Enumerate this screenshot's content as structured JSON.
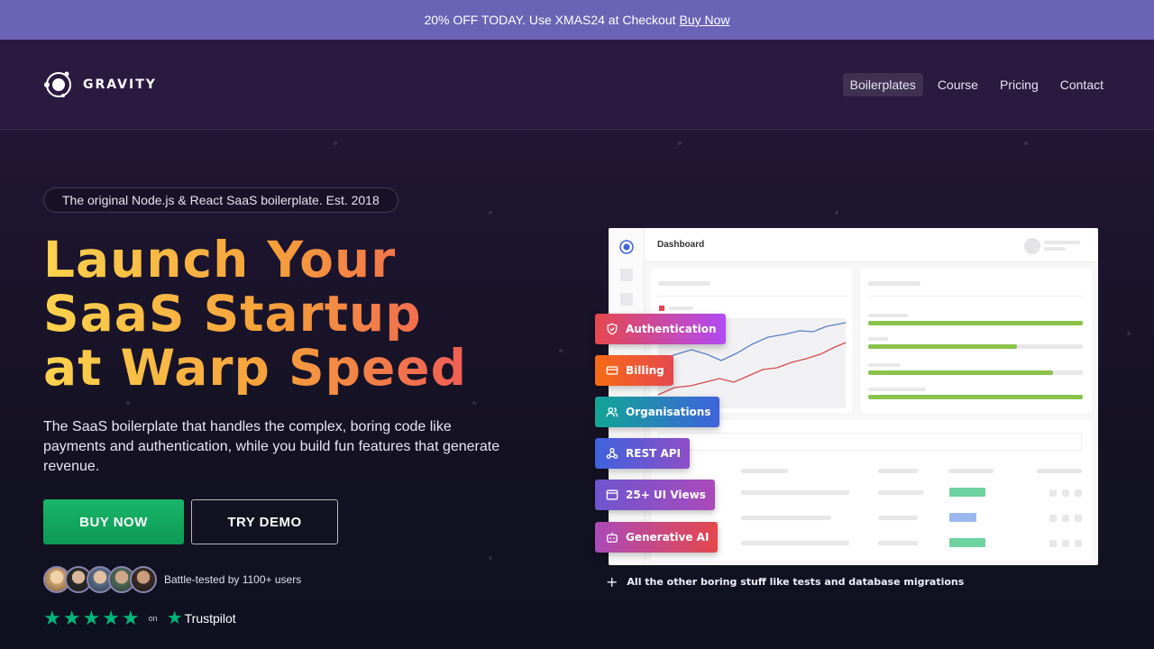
{
  "promo": {
    "text": "20% OFF TODAY. Use XMAS24 at Checkout",
    "link": "Buy Now"
  },
  "brand": {
    "name": "GRAVITY"
  },
  "nav": {
    "items": [
      {
        "label": "Boilerplates",
        "active": true
      },
      {
        "label": "Course"
      },
      {
        "label": "Pricing"
      },
      {
        "label": "Contact"
      }
    ]
  },
  "hero": {
    "badge": "The original Node.js & React SaaS boilerplate. Est. 2018",
    "headline": [
      "Launch Your",
      "SaaS Startup",
      "at Warp Speed"
    ],
    "subtitle": "The SaaS boilerplate that handles the complex, boring code like payments and authentication, while you build fun features that generate revenue.",
    "buy_label": "BUY NOW",
    "demo_label": "TRY DEMO",
    "users_text": "Battle-tested by 1100+ users",
    "rating_on": "on",
    "rating_brand": "Trustpilot",
    "rating_stars": 5
  },
  "dashboard": {
    "title": "Dashboard"
  },
  "features": [
    {
      "label": "Authentication",
      "icon": "shield-icon",
      "color_start": "#e5484d",
      "color_end": "#b14bf4"
    },
    {
      "label": "Billing",
      "icon": "credit-card-icon",
      "color_start": "#f76b15",
      "color_end": "#e5484d"
    },
    {
      "label": "Organisations",
      "icon": "users-icon",
      "color_start": "#12a594",
      "color_end": "#3e63dd"
    },
    {
      "label": "REST API",
      "icon": "webhook-icon",
      "color_start": "#3e63dd",
      "color_end": "#8e4ec6"
    },
    {
      "label": "25+ UI Views",
      "icon": "browser-icon",
      "color_start": "#6e56cf",
      "color_end": "#ab4aba"
    },
    {
      "label": "Generative AI",
      "icon": "bot-icon",
      "color_start": "#ab4aba",
      "color_end": "#e5484d"
    }
  ],
  "other_label": "All the other boring stuff like tests and database migrations",
  "colors": {
    "promo_bg": "#6b63b5",
    "buy_green": "#19b66a",
    "trustpilot_green": "#00b67a",
    "headline_start": "#fcd34d",
    "headline_end": "#ef4e5c"
  }
}
